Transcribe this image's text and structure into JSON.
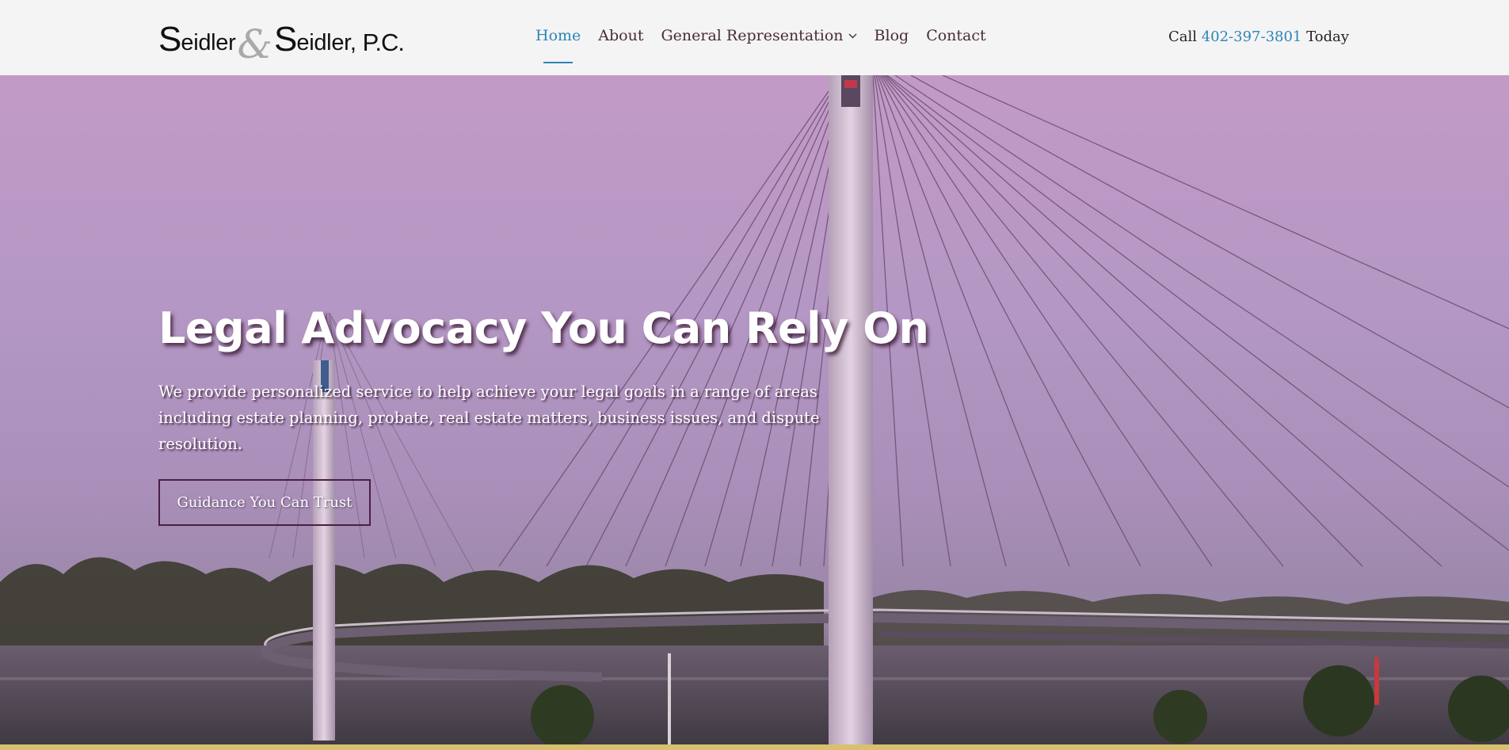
{
  "header": {
    "logo": {
      "first_initial": "S",
      "first_rest": "eidler",
      "ampersand": "&",
      "second_initial": "S",
      "second_rest": "eidler,",
      "suffix": "P.C."
    },
    "nav": [
      {
        "label": "Home",
        "active": true
      },
      {
        "label": "About",
        "active": false
      },
      {
        "label": "General Representation",
        "active": false,
        "dropdown": true
      },
      {
        "label": "Blog",
        "active": false
      },
      {
        "label": "Contact",
        "active": false
      }
    ],
    "call": {
      "prefix": "Call",
      "phone": "402-397-3801",
      "suffix": "Today"
    }
  },
  "hero": {
    "title": "Legal Advocacy You Can Rely On",
    "subtitle": "We provide personalized service to help achieve your legal goals in a range of areas including estate planning, probate, real estate matters, business issues, and dispute resolution.",
    "button_label": "Guidance You Can Trust"
  },
  "colors": {
    "accent": "#2b86b8",
    "nav_text": "#4a2b3c",
    "header_bg": "#f4f4f4",
    "button_border": "#4a1f44",
    "footer_strip": "#d8c070"
  },
  "icons": {
    "dropdown": "chevron-down-icon"
  }
}
